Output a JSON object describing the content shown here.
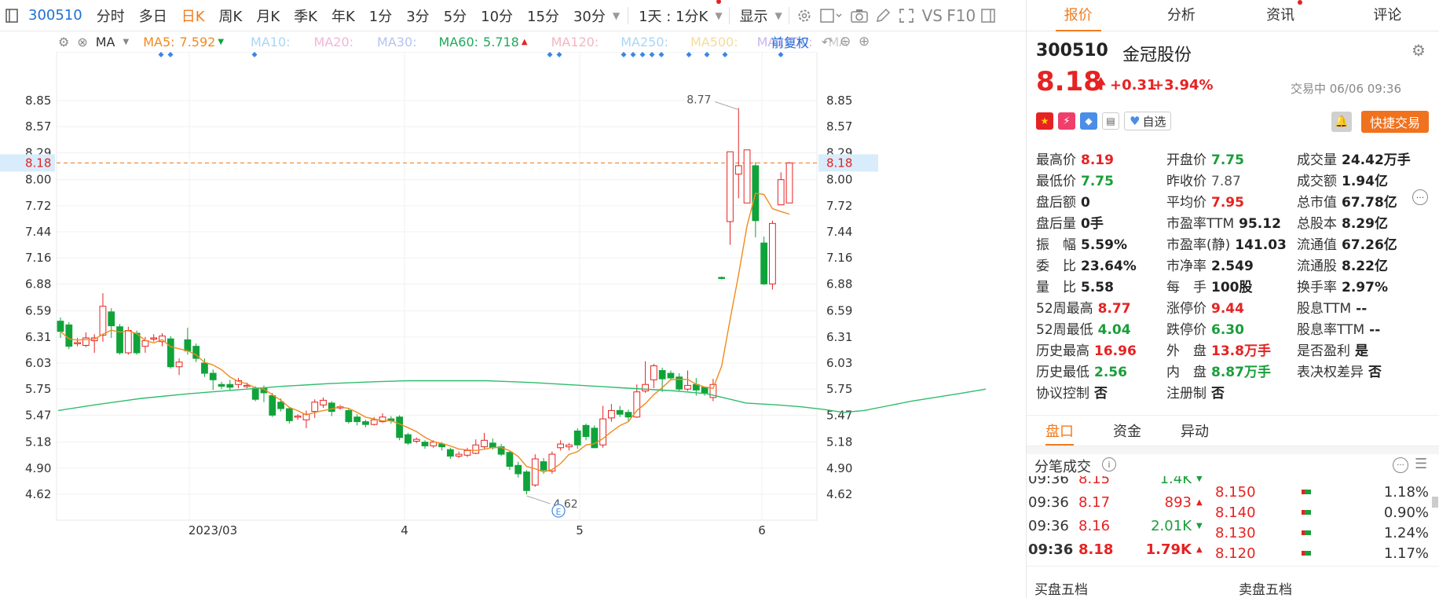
{
  "toolbar": {
    "code": "300510",
    "periods": [
      "分时",
      "多日",
      "日K",
      "周K",
      "月K",
      "季K",
      "年K",
      "1分",
      "3分",
      "5分",
      "10分",
      "15分",
      "30分"
    ],
    "active_period": "日K",
    "range": "1天 : 1分K",
    "display": "显示"
  },
  "indicators": {
    "ma": "MA",
    "ma5_label": "MA5:",
    "ma5_value": "7.592",
    "ma10": "MA10:",
    "ma20": "MA20:",
    "ma30": "MA30:",
    "ma60_label": "MA60:",
    "ma60_value": "5.718",
    "ma120": "MA120:",
    "ma250": "MA250:",
    "ma500": "MA500:",
    "ma1000": "MA1000:",
    "ma_more": "MA",
    "fuquan": "前复权"
  },
  "colors": {
    "up": "#e62222",
    "down": "#10a33a",
    "ma5": "#f28a1e",
    "ma60": "#2ebd6c",
    "accent": "#f07b1e",
    "blue": "#1f6fd6"
  },
  "chart_data": {
    "type": "candlestick",
    "y_ticks": [
      "8.85",
      "8.57",
      "8.29",
      "8.00",
      "7.72",
      "7.44",
      "7.16",
      "6.88",
      "6.59",
      "6.31",
      "6.03",
      "5.75",
      "5.47",
      "5.18",
      "4.90",
      "4.62"
    ],
    "current_price": "8.18",
    "x_labels": [
      "2023/03",
      "4",
      "5",
      "6"
    ],
    "high_label": "8.77",
    "low_label": "4.62",
    "event_marker": "E",
    "ylim": [
      4.5,
      8.95
    ],
    "candles": [
      [
        6.48,
        6.37,
        6.52,
        6.3
      ],
      [
        6.44,
        6.21,
        6.47,
        6.18
      ],
      [
        6.24,
        6.25,
        6.3,
        6.21
      ],
      [
        6.22,
        6.3,
        6.36,
        6.2
      ],
      [
        6.27,
        6.3,
        6.34,
        6.14
      ],
      [
        6.33,
        6.64,
        6.78,
        6.26
      ],
      [
        6.58,
        6.43,
        6.62,
        6.3
      ],
      [
        6.42,
        6.14,
        6.45,
        6.12
      ],
      [
        6.14,
        6.38,
        6.42,
        6.12
      ],
      [
        6.35,
        6.14,
        6.38,
        6.12
      ],
      [
        6.21,
        6.27,
        6.31,
        6.14
      ],
      [
        6.29,
        6.3,
        6.34,
        6.26
      ],
      [
        6.26,
        6.32,
        6.35,
        6.21
      ],
      [
        6.29,
        5.99,
        6.32,
        5.97
      ],
      [
        5.99,
        6.04,
        6.08,
        5.9
      ],
      [
        6.28,
        6.16,
        6.41,
        6.12
      ],
      [
        6.21,
        6.08,
        6.24,
        6.04
      ],
      [
        6.03,
        5.92,
        6.08,
        5.88
      ],
      [
        5.92,
        5.85,
        5.96,
        5.74
      ],
      [
        5.8,
        5.78,
        5.83,
        5.75
      ],
      [
        5.8,
        5.77,
        5.85,
        5.73
      ],
      [
        5.8,
        5.84,
        5.87,
        5.76
      ],
      [
        5.78,
        5.79,
        5.82,
        5.76
      ],
      [
        5.76,
        5.64,
        5.78,
        5.62
      ],
      [
        5.76,
        5.71,
        5.79,
        5.61
      ],
      [
        5.68,
        5.47,
        5.71,
        5.45
      ],
      [
        5.61,
        5.54,
        5.65,
        5.51
      ],
      [
        5.54,
        5.41,
        5.56,
        5.38
      ],
      [
        5.45,
        5.46,
        5.48,
        5.42
      ],
      [
        5.42,
        5.48,
        5.52,
        5.33
      ],
      [
        5.51,
        5.61,
        5.64,
        5.44
      ],
      [
        5.58,
        5.63,
        5.66,
        5.55
      ],
      [
        5.6,
        5.51,
        5.62,
        5.46
      ],
      [
        5.55,
        5.56,
        5.58,
        5.53
      ],
      [
        5.52,
        5.4,
        5.55,
        5.38
      ],
      [
        5.45,
        5.4,
        5.48,
        5.36
      ],
      [
        5.4,
        5.37,
        5.42,
        5.34
      ],
      [
        5.37,
        5.42,
        5.45,
        5.36
      ],
      [
        5.4,
        5.45,
        5.49,
        5.39
      ],
      [
        5.43,
        5.41,
        5.46,
        5.38
      ],
      [
        5.45,
        5.23,
        5.47,
        5.2
      ],
      [
        5.26,
        5.17,
        5.28,
        5.15
      ],
      [
        5.19,
        5.21,
        5.23,
        5.17
      ],
      [
        5.18,
        5.14,
        5.2,
        5.11
      ],
      [
        5.14,
        5.18,
        5.2,
        5.12
      ],
      [
        5.16,
        5.13,
        5.18,
        5.09
      ],
      [
        5.1,
        5.03,
        5.12,
        5.0
      ],
      [
        5.03,
        5.05,
        5.08,
        5.01
      ],
      [
        5.04,
        5.09,
        5.12,
        5.02
      ],
      [
        5.06,
        5.15,
        5.21,
        5.05
      ],
      [
        5.13,
        5.2,
        5.28,
        5.11
      ],
      [
        5.17,
        5.12,
        5.22,
        5.1
      ],
      [
        5.13,
        5.05,
        5.16,
        5.03
      ],
      [
        5.07,
        4.92,
        5.09,
        4.88
      ],
      [
        4.93,
        4.84,
        4.97,
        4.8
      ],
      [
        4.86,
        4.66,
        4.88,
        4.62
      ],
      [
        4.72,
        5.0,
        5.05,
        4.7
      ],
      [
        4.97,
        4.88,
        5.01,
        4.84
      ],
      [
        4.87,
        5.05,
        5.08,
        4.84
      ],
      [
        5.12,
        5.16,
        5.2,
        5.09
      ],
      [
        5.13,
        5.15,
        5.17,
        5.09
      ],
      [
        5.3,
        5.15,
        5.33,
        5.11
      ],
      [
        5.36,
        5.24,
        5.38,
        5.2
      ],
      [
        5.33,
        5.12,
        5.36,
        5.12
      ],
      [
        5.15,
        5.43,
        5.57,
        5.12
      ],
      [
        5.44,
        5.52,
        5.59,
        5.4
      ],
      [
        5.52,
        5.48,
        5.57,
        5.45
      ],
      [
        5.5,
        5.45,
        5.53,
        5.4
      ],
      [
        5.45,
        5.72,
        5.8,
        5.44
      ],
      [
        5.73,
        5.8,
        6.05,
        5.71
      ],
      [
        5.85,
        6.0,
        6.02,
        5.76
      ],
      [
        5.95,
        5.86,
        5.98,
        5.72
      ],
      [
        5.92,
        5.87,
        5.95,
        5.85
      ],
      [
        5.88,
        5.75,
        5.92,
        5.73
      ],
      [
        5.75,
        5.79,
        5.95,
        5.73
      ],
      [
        5.8,
        5.74,
        5.87,
        5.68
      ],
      [
        5.77,
        5.71,
        5.75,
        5.68
      ],
      [
        5.66,
        5.8,
        5.86,
        5.62
      ],
      [
        6.95,
        6.94,
        6.96,
        6.93
      ],
      [
        7.55,
        8.3,
        8.3,
        7.3
      ],
      [
        8.06,
        8.15,
        8.77,
        7.8
      ],
      [
        7.75,
        8.32,
        8.32,
        7.75
      ],
      [
        8.15,
        7.56,
        8.19,
        7.38
      ],
      [
        7.32,
        6.88,
        7.39,
        6.87
      ],
      [
        6.88,
        7.53,
        7.56,
        6.82
      ],
      [
        7.73,
        8.0,
        8.08,
        7.73
      ],
      [
        7.75,
        8.18,
        8.19,
        7.75
      ]
    ],
    "ma60": [
      [
        74,
        5.52
      ],
      [
        120,
        5.58
      ],
      [
        180,
        5.65
      ],
      [
        240,
        5.7
      ],
      [
        300,
        5.74
      ],
      [
        360,
        5.78
      ],
      [
        420,
        5.81
      ],
      [
        480,
        5.83
      ],
      [
        520,
        5.84
      ],
      [
        560,
        5.84
      ],
      [
        620,
        5.84
      ],
      [
        680,
        5.82
      ],
      [
        740,
        5.79
      ],
      [
        800,
        5.76
      ],
      [
        860,
        5.73
      ],
      [
        900,
        5.7
      ],
      [
        950,
        5.6
      ],
      [
        990,
        5.58
      ],
      [
        1020,
        5.56
      ],
      [
        1050,
        5.53
      ],
      [
        1074,
        5.5
      ],
      [
        1100,
        5.52
      ],
      [
        1130,
        5.57
      ],
      [
        1160,
        5.62
      ],
      [
        1190,
        5.66
      ],
      [
        1220,
        5.7
      ],
      [
        1255,
        5.75
      ]
    ]
  },
  "panel": {
    "tabs": [
      {
        "label": "报价",
        "active": true
      },
      {
        "label": "分析"
      },
      {
        "label": "资讯",
        "dot": true
      },
      {
        "label": "评论"
      }
    ],
    "code": "300510",
    "name": "金冠股份",
    "price": "8.18",
    "change": "+0.31",
    "pct": "+3.94%",
    "status": "交易中 06/06 09:36",
    "watch": "自选",
    "trade": "快捷交易",
    "grid": [
      [
        [
          "最高价",
          "8.19",
          "red"
        ],
        [
          "开盘价",
          "7.75",
          "green"
        ],
        [
          "成交量",
          "24.42万手",
          ""
        ]
      ],
      [
        [
          "最低价",
          "7.75",
          "green"
        ],
        [
          "昨收价",
          "7.87",
          "gray"
        ],
        [
          "成交额",
          "1.94亿",
          ""
        ]
      ],
      [
        [
          "盘后额",
          "0",
          ""
        ],
        [
          "平均价",
          "7.95",
          "red"
        ],
        [
          "总市值",
          "67.78亿",
          ""
        ]
      ],
      [
        [
          "盘后量",
          "0手",
          ""
        ],
        [
          "市盈率TTM",
          "95.12",
          ""
        ],
        [
          "总股本",
          "8.29亿",
          ""
        ]
      ],
      [
        [
          "振　幅",
          "5.59%",
          ""
        ],
        [
          "市盈率(静)",
          "141.03",
          ""
        ],
        [
          "流通值",
          "67.26亿",
          ""
        ]
      ],
      [
        [
          "委　比",
          "23.64%",
          ""
        ],
        [
          "市净率",
          "2.549",
          ""
        ],
        [
          "流通股",
          "8.22亿",
          ""
        ]
      ],
      [
        [
          "量　比",
          "5.58",
          ""
        ],
        [
          "每　手",
          "100股",
          ""
        ],
        [
          "换手率",
          "2.97%",
          ""
        ]
      ],
      [
        [
          "52周最高",
          "8.77",
          "red"
        ],
        [
          "涨停价",
          "9.44",
          "red"
        ],
        [
          "股息TTM",
          "--",
          ""
        ]
      ],
      [
        [
          "52周最低",
          "4.04",
          "green"
        ],
        [
          "跌停价",
          "6.30",
          "green"
        ],
        [
          "股息率TTM",
          "--",
          ""
        ]
      ],
      [
        [
          "历史最高",
          "16.96",
          "red"
        ],
        [
          "外　盘",
          "13.8万手",
          "red"
        ],
        [
          "是否盈利",
          "是",
          ""
        ]
      ],
      [
        [
          "历史最低",
          "2.56",
          "green"
        ],
        [
          "内　盘",
          "8.87万手",
          "green"
        ],
        [
          "表决权差异",
          "否",
          ""
        ]
      ],
      [
        [
          "协议控制",
          "否",
          ""
        ],
        [
          "注册制",
          "否",
          ""
        ],
        [
          "",
          "",
          ""
        ]
      ]
    ],
    "subtabs": [
      "盘口",
      "资金",
      "异动"
    ],
    "ticks_title": "分笔成交",
    "ticks": [
      {
        "time": "09:36",
        "price": "8.15",
        "vol": "1.4K",
        "dir": "down"
      },
      {
        "time": "09:36",
        "price": "8.17",
        "vol": "893",
        "dir": "up"
      },
      {
        "time": "09:36",
        "price": "8.16",
        "vol": "2.01K",
        "dir": "down"
      },
      {
        "time": "09:36",
        "price": "8.18",
        "vol": "1.79K",
        "dir": "up"
      }
    ],
    "levels": [
      {
        "price": "8.150",
        "pct": "1.18%"
      },
      {
        "price": "8.140",
        "pct": "0.90%"
      },
      {
        "price": "8.130",
        "pct": "1.24%"
      },
      {
        "price": "8.120",
        "pct": "1.17%"
      }
    ],
    "buy5": "买盘五档",
    "sell5": "卖盘五档"
  }
}
